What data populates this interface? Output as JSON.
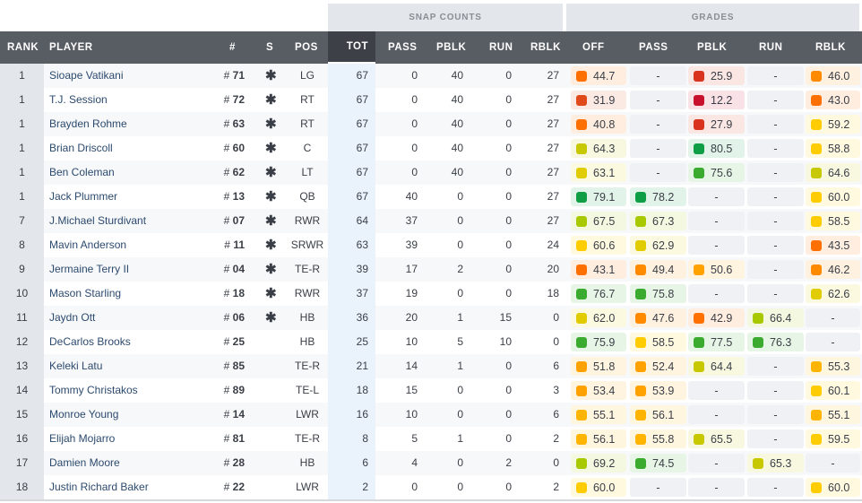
{
  "groups": {
    "snap_counts": "SNAP COUNTS",
    "grades": "GRADES"
  },
  "headers": {
    "rank": "RANK",
    "player": "PLAYER",
    "number": "#",
    "starter": "S",
    "pos": "POS",
    "tot": "TOT",
    "pass": "PASS",
    "pblk": "PBLK",
    "run": "RUN",
    "rblk": "RBLK",
    "g_off": "OFF",
    "g_pass": "PASS",
    "g_pblk": "PBLK",
    "g_run": "RUN",
    "g_rblk": "RBLK"
  },
  "starter_icon": "asterisk-icon",
  "starter_glyph": "✱",
  "rows": [
    {
      "rank": "1",
      "player": "Sioape Vatikani",
      "num": "71",
      "starter": true,
      "pos": "LG",
      "tot": "67",
      "pass": "0",
      "pblk": "40",
      "run": "0",
      "rblk": "27",
      "grades": {
        "off": "44.7",
        "pass": "-",
        "pblk": "25.9",
        "run": "-",
        "rblk": "46.0"
      }
    },
    {
      "rank": "1",
      "player": "T.J. Session",
      "num": "72",
      "starter": true,
      "pos": "RT",
      "tot": "67",
      "pass": "0",
      "pblk": "40",
      "run": "0",
      "rblk": "27",
      "grades": {
        "off": "31.9",
        "pass": "-",
        "pblk": "12.2",
        "run": "-",
        "rblk": "43.0"
      }
    },
    {
      "rank": "1",
      "player": "Brayden Rohme",
      "num": "63",
      "starter": true,
      "pos": "RT",
      "tot": "67",
      "pass": "0",
      "pblk": "40",
      "run": "0",
      "rblk": "27",
      "grades": {
        "off": "40.8",
        "pass": "-",
        "pblk": "27.9",
        "run": "-",
        "rblk": "59.2"
      }
    },
    {
      "rank": "1",
      "player": "Brian Driscoll",
      "num": "60",
      "starter": true,
      "pos": "C",
      "tot": "67",
      "pass": "0",
      "pblk": "40",
      "run": "0",
      "rblk": "27",
      "grades": {
        "off": "64.3",
        "pass": "-",
        "pblk": "80.5",
        "run": "-",
        "rblk": "58.8"
      }
    },
    {
      "rank": "1",
      "player": "Ben Coleman",
      "num": "62",
      "starter": true,
      "pos": "LT",
      "tot": "67",
      "pass": "0",
      "pblk": "40",
      "run": "0",
      "rblk": "27",
      "grades": {
        "off": "63.1",
        "pass": "-",
        "pblk": "75.6",
        "run": "-",
        "rblk": "64.6"
      }
    },
    {
      "rank": "1",
      "player": "Jack Plummer",
      "num": "13",
      "starter": true,
      "pos": "QB",
      "tot": "67",
      "pass": "40",
      "pblk": "0",
      "run": "0",
      "rblk": "27",
      "grades": {
        "off": "79.1",
        "pass": "78.2",
        "pblk": "-",
        "run": "-",
        "rblk": "60.0"
      }
    },
    {
      "rank": "7",
      "player": "J.Michael Sturdivant",
      "num": "07",
      "starter": true,
      "pos": "RWR",
      "tot": "64",
      "pass": "37",
      "pblk": "0",
      "run": "0",
      "rblk": "27",
      "grades": {
        "off": "67.5",
        "pass": "67.3",
        "pblk": "-",
        "run": "-",
        "rblk": "58.5"
      }
    },
    {
      "rank": "8",
      "player": "Mavin Anderson",
      "num": "11",
      "starter": true,
      "pos": "SRWR",
      "tot": "63",
      "pass": "39",
      "pblk": "0",
      "run": "0",
      "rblk": "24",
      "grades": {
        "off": "60.6",
        "pass": "62.9",
        "pblk": "-",
        "run": "-",
        "rblk": "43.5"
      }
    },
    {
      "rank": "9",
      "player": "Jermaine Terry II",
      "num": "04",
      "starter": true,
      "pos": "TE-R",
      "tot": "39",
      "pass": "17",
      "pblk": "2",
      "run": "0",
      "rblk": "20",
      "grades": {
        "off": "43.1",
        "pass": "49.4",
        "pblk": "50.6",
        "run": "-",
        "rblk": "46.2"
      }
    },
    {
      "rank": "10",
      "player": "Mason Starling",
      "num": "18",
      "starter": true,
      "pos": "RWR",
      "tot": "37",
      "pass": "19",
      "pblk": "0",
      "run": "0",
      "rblk": "18",
      "grades": {
        "off": "76.7",
        "pass": "75.8",
        "pblk": "-",
        "run": "-",
        "rblk": "62.6"
      }
    },
    {
      "rank": "11",
      "player": "Jaydn Ott",
      "num": "06",
      "starter": true,
      "pos": "HB",
      "tot": "36",
      "pass": "20",
      "pblk": "1",
      "run": "15",
      "rblk": "0",
      "grades": {
        "off": "62.0",
        "pass": "47.6",
        "pblk": "42.9",
        "run": "66.4",
        "rblk": "-"
      }
    },
    {
      "rank": "12",
      "player": "DeCarlos Brooks",
      "num": "25",
      "starter": false,
      "pos": "HB",
      "tot": "25",
      "pass": "10",
      "pblk": "5",
      "run": "10",
      "rblk": "0",
      "grades": {
        "off": "75.9",
        "pass": "58.5",
        "pblk": "77.5",
        "run": "76.3",
        "rblk": "-"
      }
    },
    {
      "rank": "13",
      "player": "Keleki Latu",
      "num": "85",
      "starter": false,
      "pos": "TE-R",
      "tot": "21",
      "pass": "14",
      "pblk": "1",
      "run": "0",
      "rblk": "6",
      "grades": {
        "off": "51.8",
        "pass": "52.4",
        "pblk": "64.4",
        "run": "-",
        "rblk": "55.3"
      }
    },
    {
      "rank": "14",
      "player": "Tommy Christakos",
      "num": "89",
      "starter": false,
      "pos": "TE-L",
      "tot": "18",
      "pass": "15",
      "pblk": "0",
      "run": "0",
      "rblk": "3",
      "grades": {
        "off": "53.4",
        "pass": "53.9",
        "pblk": "-",
        "run": "-",
        "rblk": "60.1"
      }
    },
    {
      "rank": "15",
      "player": "Monroe Young",
      "num": "14",
      "starter": false,
      "pos": "LWR",
      "tot": "16",
      "pass": "10",
      "pblk": "0",
      "run": "0",
      "rblk": "6",
      "grades": {
        "off": "55.1",
        "pass": "56.1",
        "pblk": "-",
        "run": "-",
        "rblk": "55.1"
      }
    },
    {
      "rank": "16",
      "player": "Elijah Mojarro",
      "num": "81",
      "starter": false,
      "pos": "TE-R",
      "tot": "8",
      "pass": "5",
      "pblk": "1",
      "run": "0",
      "rblk": "2",
      "grades": {
        "off": "56.1",
        "pass": "55.8",
        "pblk": "65.5",
        "run": "-",
        "rblk": "59.5"
      }
    },
    {
      "rank": "17",
      "player": "Damien Moore",
      "num": "28",
      "starter": false,
      "pos": "HB",
      "tot": "6",
      "pass": "4",
      "pblk": "0",
      "run": "2",
      "rblk": "0",
      "grades": {
        "off": "69.2",
        "pass": "74.5",
        "pblk": "-",
        "run": "65.3",
        "rblk": "-"
      }
    },
    {
      "rank": "18",
      "player": "Justin Richard Baker",
      "num": "22",
      "starter": false,
      "pos": "LWR",
      "tot": "2",
      "pass": "0",
      "pblk": "0",
      "run": "0",
      "rblk": "2",
      "grades": {
        "off": "60.0",
        "pass": "-",
        "pblk": "-",
        "run": "-",
        "rblk": "60.0"
      }
    }
  ],
  "grade_colors": {
    "below_20": "#c8102e",
    "20_30": "#d9331f",
    "30_40": "#e04a1a",
    "40_45": "#ff7000",
    "45_50": "#ff8a00",
    "50_55": "#ffa200",
    "55_58": "#ffb400",
    "58_61": "#ffcc00",
    "61_64": "#e0cc00",
    "64_66": "#c8c800",
    "66_70": "#a8c800",
    "70_78": "#3aab2e",
    "78_plus": "#0f9d45"
  }
}
